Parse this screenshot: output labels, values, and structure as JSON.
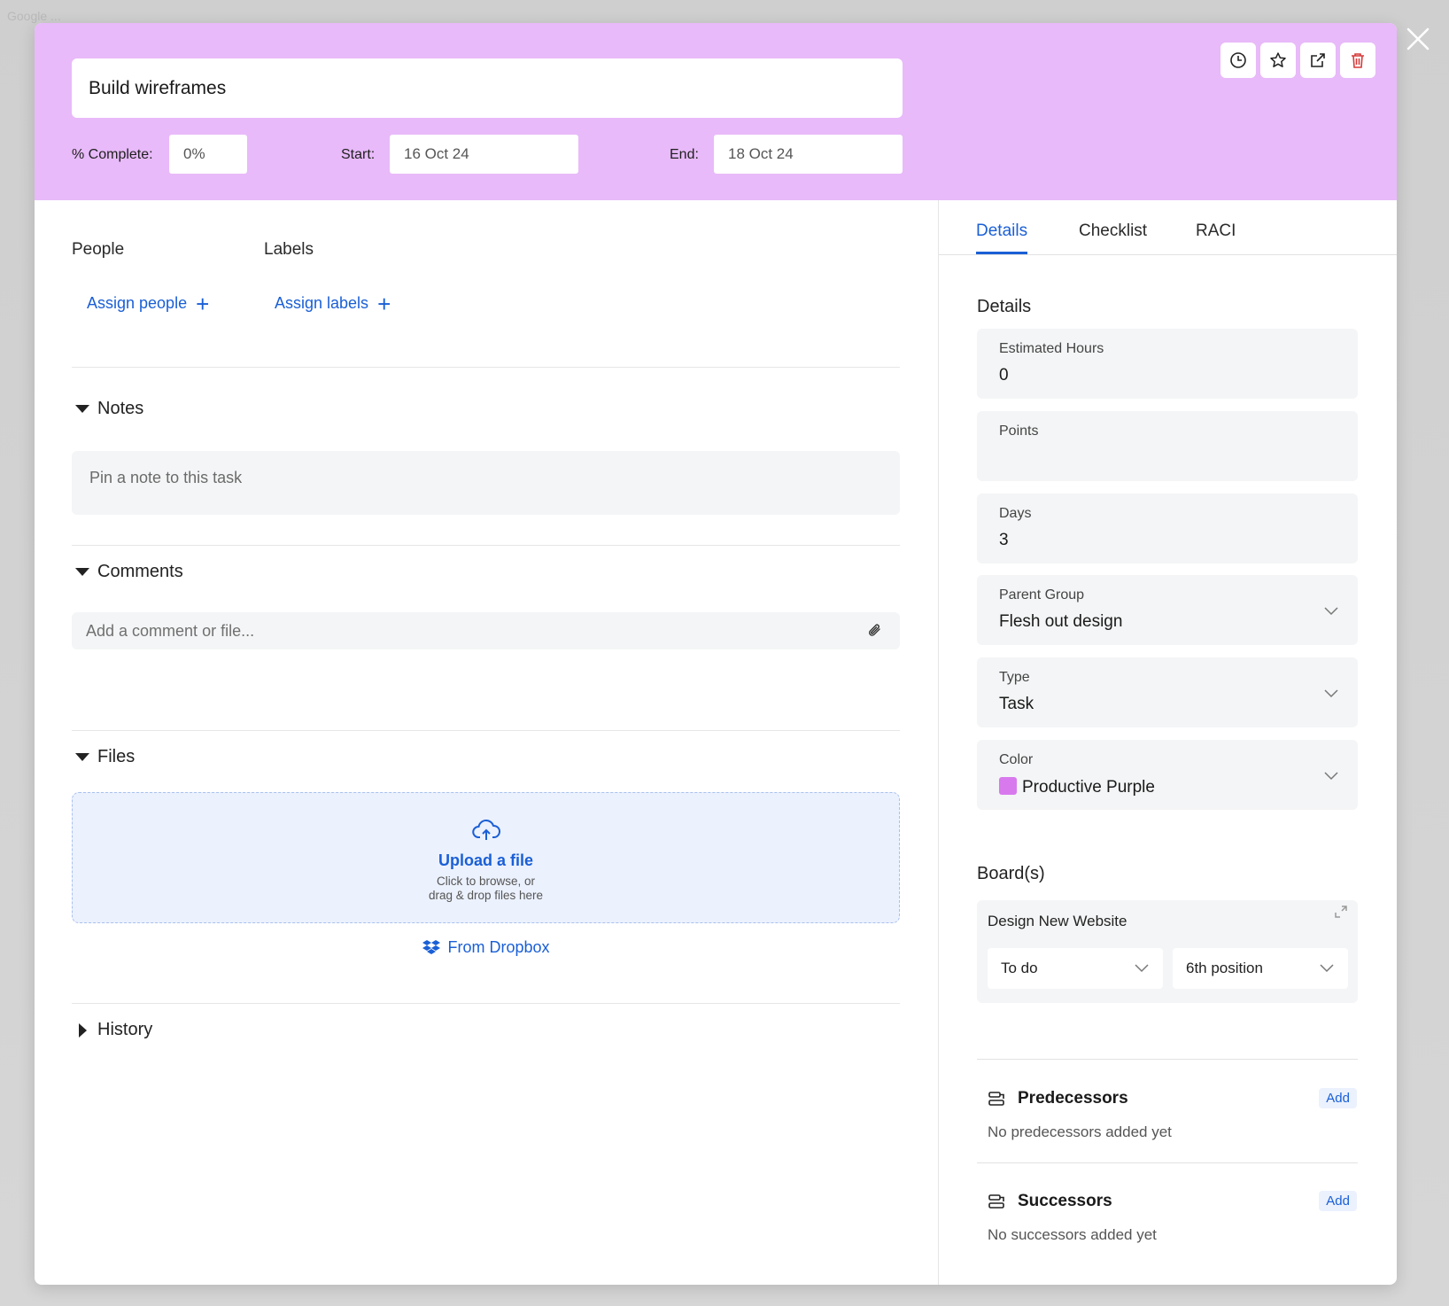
{
  "background": {
    "blurred_text": "Google  ..."
  },
  "header": {
    "title": "Build wireframes",
    "complete_label": "% Complete:",
    "complete_value": "0%",
    "start_label": "Start:",
    "start_value": "16 Oct 24",
    "end_label": "End:",
    "end_value": "18 Oct 24",
    "color": "#e8baf9"
  },
  "left": {
    "people_label": "People",
    "labels_label": "Labels",
    "assign_people": "Assign people",
    "assign_labels": "Assign labels",
    "notes_title": "Notes",
    "notes_placeholder": "Pin a note to this task",
    "comments_title": "Comments",
    "comment_placeholder": "Add a comment or file...",
    "files_title": "Files",
    "upload_title": "Upload a file",
    "upload_sub1": "Click to browse, or",
    "upload_sub2": "drag & drop files here",
    "dropbox": "From Dropbox",
    "history_title": "History"
  },
  "right": {
    "tabs": [
      "Details",
      "Checklist",
      "RACI"
    ],
    "details_title": "Details",
    "fields": [
      {
        "label": "Estimated Hours",
        "value": "0"
      },
      {
        "label": "Points",
        "value": ""
      },
      {
        "label": "Days",
        "value": "3"
      },
      {
        "label": "Parent Group",
        "value": "Flesh out design"
      },
      {
        "label": "Type",
        "value": "Task"
      },
      {
        "label": "Color",
        "value": "Productive Purple",
        "swatch": "#d879ee"
      }
    ],
    "boards_title": "Board(s)",
    "board": {
      "name": "Design New Website",
      "status": "To do",
      "position": "6th position"
    },
    "predecessors": {
      "title": "Predecessors",
      "add": "Add",
      "empty": "No predecessors added yet"
    },
    "successors": {
      "title": "Successors",
      "add": "Add",
      "empty": "No successors added yet"
    }
  },
  "colors": {
    "accent": "#1a5fd6",
    "danger": "#d63a3a"
  }
}
